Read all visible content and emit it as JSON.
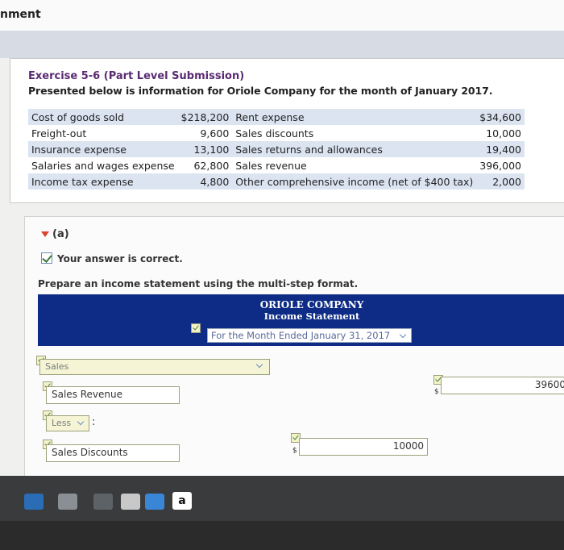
{
  "page": {
    "heading_partial": "nment"
  },
  "exercise": {
    "title": "Exercise 5-6 (Part Level Submission)",
    "description": "Presented below is information for Oriole Company for the month of January 2017."
  },
  "data_table": {
    "rows": [
      {
        "label1": "Cost of goods sold",
        "value1": "$218,200",
        "label2": "Rent expense",
        "value2": "$34,600"
      },
      {
        "label1": "Freight-out",
        "value1": "9,600",
        "label2": "Sales discounts",
        "value2": "10,000"
      },
      {
        "label1": "Insurance expense",
        "value1": "13,100",
        "label2": "Sales returns and allowances",
        "value2": "19,400"
      },
      {
        "label1": "Salaries and wages expense",
        "value1": "62,800",
        "label2": "Sales revenue",
        "value2": "396,000"
      },
      {
        "label1": "Income tax expense",
        "value1": "4,800",
        "label2": "Other comprehensive income (net of $400 tax)",
        "value2": "2,000"
      }
    ]
  },
  "part_a": {
    "label": "(a)",
    "feedback": "Your answer is correct.",
    "instructions": "Prepare an income statement using the multi-step format."
  },
  "statement": {
    "company": "ORIOLE COMPANY",
    "name": "Income Statement",
    "period": "For the Month Ended January 31, 2017"
  },
  "form": {
    "sales_select": "Sales",
    "sales_revenue_label": "Sales Revenue",
    "sales_revenue_amount": "39600",
    "less_select": "Less",
    "less_colon": ":",
    "sales_discounts_label": "Sales Discounts",
    "sales_discounts_amount": "10000",
    "dollar_sign": "$"
  },
  "taskbar": {
    "a_label": "a"
  },
  "colors": {
    "header_blue": "#0e2c86",
    "table_stripe": "#dce4f2",
    "title_purple": "#5a2a72"
  }
}
